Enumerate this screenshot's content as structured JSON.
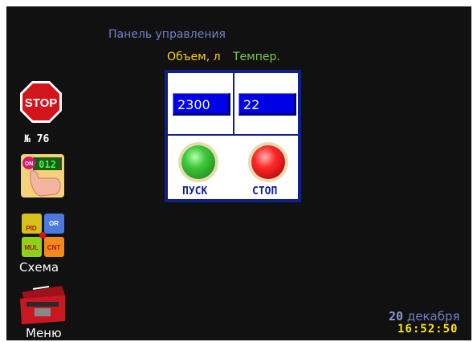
{
  "screen": {
    "title": "Панель управления",
    "labels": {
      "volume": "Объем, л",
      "temperature": "Темпер."
    }
  },
  "fields": {
    "volume": "2300",
    "temperature": "22"
  },
  "buttons": {
    "start": "ПУСК",
    "stop": "СТОП"
  },
  "sidebar": {
    "stop_icon": "stop-sign-icon",
    "stop_label": "STOP",
    "number": "№ 76",
    "scheme_label": "Схема",
    "scheme_blocks": [
      "PID",
      "OR",
      "MUL",
      "CNT"
    ],
    "menu_label": "Меню"
  },
  "hand_display": {
    "on": "ON",
    "value": "012"
  },
  "footer": {
    "day": "20",
    "month": "декабря",
    "time": "16:52:50"
  },
  "colors": {
    "field_bg": "#0000e6",
    "title": "#6e84c8",
    "volume_label": "#ffd400",
    "temp_label": "#7fc84a",
    "time": "#ffe600"
  }
}
